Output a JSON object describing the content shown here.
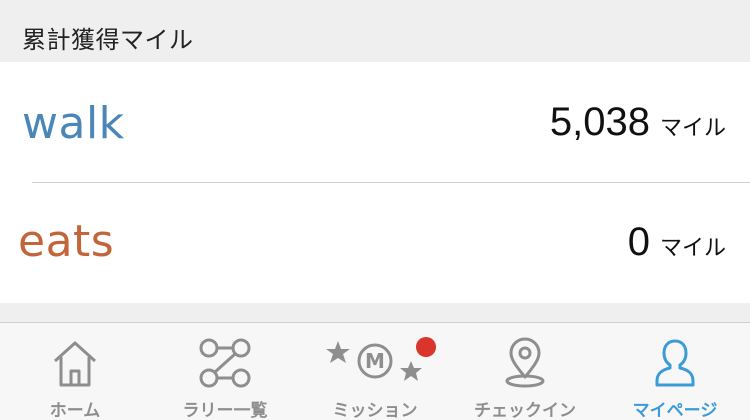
{
  "header": {
    "title": "累計獲得マイル"
  },
  "rows": [
    {
      "brand": "walk",
      "value": "5,038",
      "unit": "マイル"
    },
    {
      "brand": "eats",
      "value": "0",
      "unit": "マイル"
    }
  ],
  "tabs": [
    {
      "label": "ホーム",
      "icon": "home-icon",
      "active": false
    },
    {
      "label": "ラリー一覧",
      "icon": "rally-list-icon",
      "active": false
    },
    {
      "label": "ミッション",
      "icon": "mission-icon",
      "active": false,
      "badge": true
    },
    {
      "label": "チェックイン",
      "icon": "location-pin-icon",
      "active": false
    },
    {
      "label": "マイページ",
      "icon": "person-icon",
      "active": true
    }
  ],
  "colors": {
    "walk_brand": "#4a87b8",
    "eats_brand": "#c2653a",
    "tab_active": "#3b9bd8",
    "tab_inactive": "#8e8e8e",
    "badge": "#d9352b"
  }
}
